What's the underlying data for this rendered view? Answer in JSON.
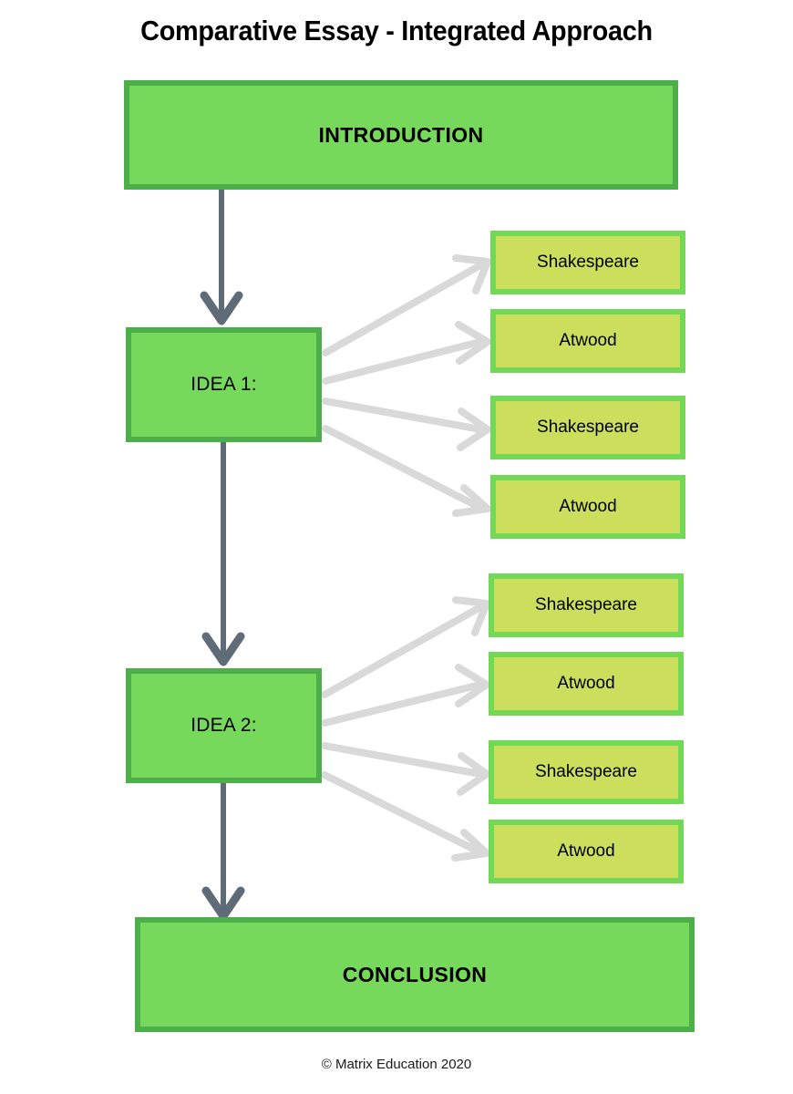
{
  "page": {
    "title": "Comparative Essay - Integrated Approach",
    "footer": "© Matrix Education 2020"
  },
  "colors": {
    "main_box_fill": "#76D95C",
    "main_box_border": "#4CAF4A",
    "side_box_fill": "#CBDF5C",
    "side_box_border": "#72D957",
    "spine_arrow": "#5F6B76",
    "fan_arrow": "#D9D9D9",
    "text": "#000000",
    "background": "#FFFFFF"
  },
  "flow": {
    "introduction": {
      "label": "INTRODUCTION"
    },
    "conclusion": {
      "label": "CONCLUSION"
    },
    "ideas": [
      {
        "label": "IDEA 1:",
        "evidence": [
          {
            "label": "Shakespeare"
          },
          {
            "label": "Atwood"
          },
          {
            "label": "Shakespeare"
          },
          {
            "label": "Atwood"
          }
        ]
      },
      {
        "label": "IDEA 2:",
        "evidence": [
          {
            "label": "Shakespeare"
          },
          {
            "label": "Atwood"
          },
          {
            "label": "Shakespeare"
          },
          {
            "label": "Atwood"
          }
        ]
      }
    ]
  }
}
